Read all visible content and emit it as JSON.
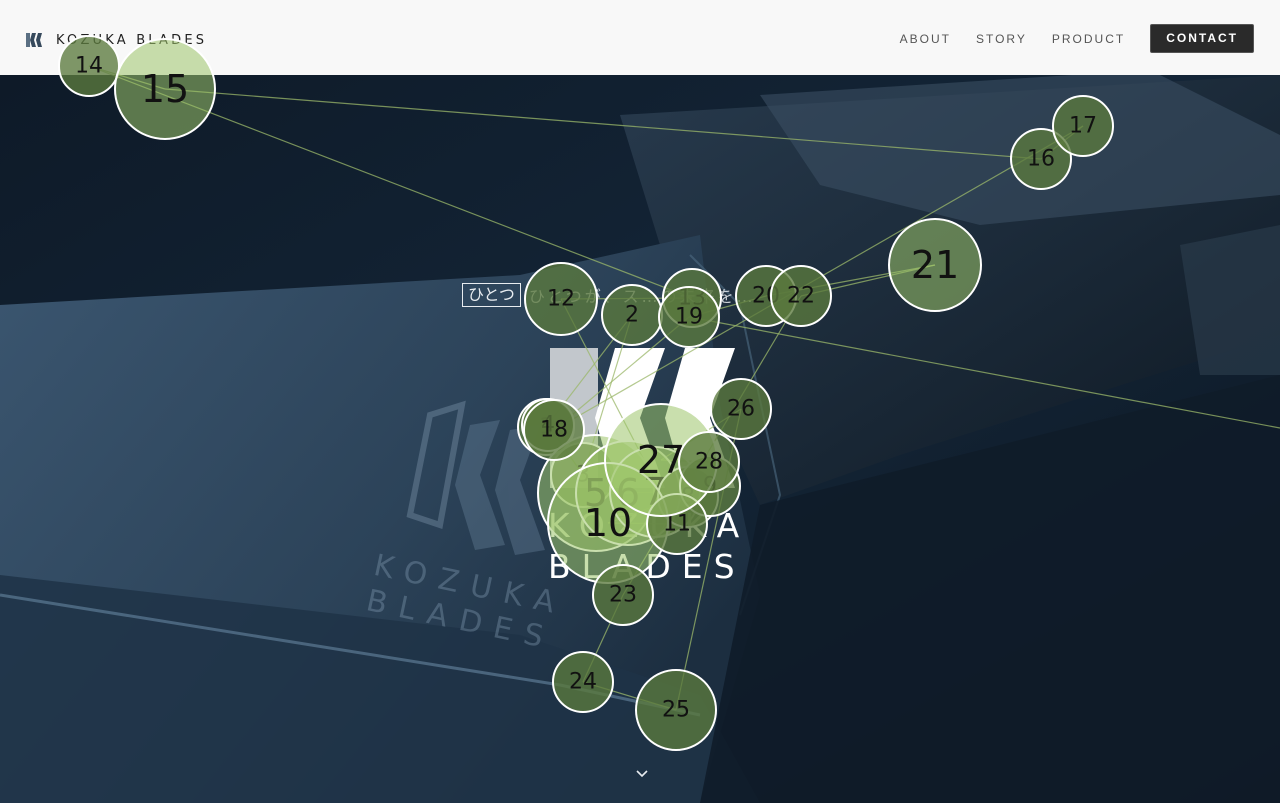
{
  "header": {
    "logo_text": "KOZUKA BLADES",
    "nav": [
      {
        "label": "ABOUT"
      },
      {
        "label": "STORY"
      },
      {
        "label": "PRODUCT"
      }
    ],
    "contact_label": "CONTACT"
  },
  "hero": {
    "tagline_boxed": "ひとつ",
    "tagline_rest": "ひとつが、ス…の未来を…",
    "logo_line1": "KOZUKA",
    "logo_line2": "BLADES",
    "bg_logo_line1": "KOZUKA",
    "bg_logo_line2": "BLADES"
  },
  "colors": {
    "accent_green": "#5b7a3e",
    "light_green": "#9dc56a",
    "header_bg": "#f8f8f8",
    "contact_bg": "#2a2a2a"
  },
  "icons": {
    "logo": "kozuka-logo-icon",
    "scroll": "chevron-down-icon"
  }
}
